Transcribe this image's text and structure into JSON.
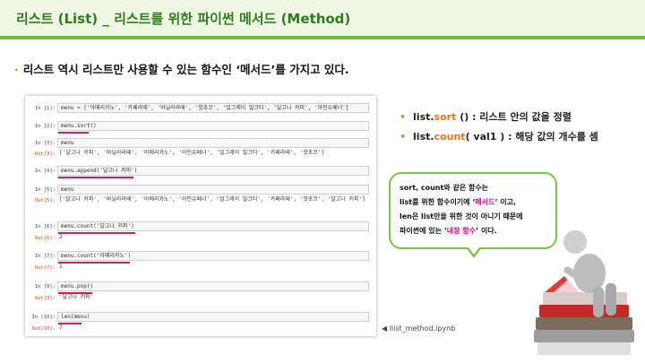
{
  "header": {
    "title": "리스트 (List) _ 리스트를 위한 파이썬 메서드 (Method)"
  },
  "main_bullet": "리스트 역시 리스트만 사용할 수 있는 함수인 ‘메서드’를 가지고 있다.",
  "notebook": {
    "cells": [
      {
        "in": "In [1]:",
        "code": "menu = ['아메리카노', '카페라떼', '바닐라라떼', '핫초코', '얼그레이 밀크티', '달고나 커피', '아인슈페너']"
      },
      {
        "in": "In [2]:",
        "code": "menu.sort()"
      },
      {
        "in": "In [3]:",
        "code": "menu",
        "out_label": "Out[3]:",
        "out": "['달고나 커피', '바닐라라떼', '아메리카노', '아인슈페너', '얼그레이 밀크티', '카페라떼', '핫초코']"
      },
      {
        "in": "In [4]:",
        "code": "menu.append('달고나 커피')"
      },
      {
        "in": "In [5]:",
        "code": "menu",
        "out_label": "Out[5]:",
        "out": "['달고나 커피', '바닐라라떼', '아메리카노', '아인슈페너', '얼그레이 밀크티', '카페라떼', '핫초코', '달고나 커피']"
      },
      {
        "in": "In [6]:",
        "code": "menu.count('달고나 커피')",
        "out_label": "Out[6]:",
        "out": "2"
      },
      {
        "in": "In [7]:",
        "code": "menu.count('아메리카노')",
        "out_label": "Out[7]:",
        "out": "1"
      },
      {
        "in": "In [9]:",
        "code": "menu.pop()",
        "out_label": "Out[9]:",
        "out": "'달고나 커피'"
      },
      {
        "in": "In [10]:",
        "code": "len(menu)",
        "out_label": "Out[10]:",
        "out": "7"
      }
    ]
  },
  "side": {
    "item1_prefix": "list.",
    "item1_method": "sort",
    "item1_rest": " () : 리스트 안의 값을 정렬",
    "item2_prefix": "list.",
    "item2_method": "count",
    "item2_rest": "( val1 ) : 해당 값의 개수를 셈"
  },
  "callout": {
    "line1": "sort, count와 같은 함수는",
    "line2_a": "list를 위한 함수이기에 ‘",
    "line2_b": "메서드",
    "line2_c": "’ 이고,",
    "line3": "len은 list만을 위한 것이 아니기 때문에",
    "line4_a": "파이썬에 있는 ‘",
    "line4_b": "내장 함수",
    "line4_c": "’ 이다."
  },
  "file_label": "◀ llist_method.ipynb",
  "colors": {
    "accent_green": "#6bbf3b",
    "title_green": "#2e7d1b",
    "method_orange": "#e8731a",
    "highlight_pink": "#e4007f",
    "underline": "#d81b60"
  }
}
